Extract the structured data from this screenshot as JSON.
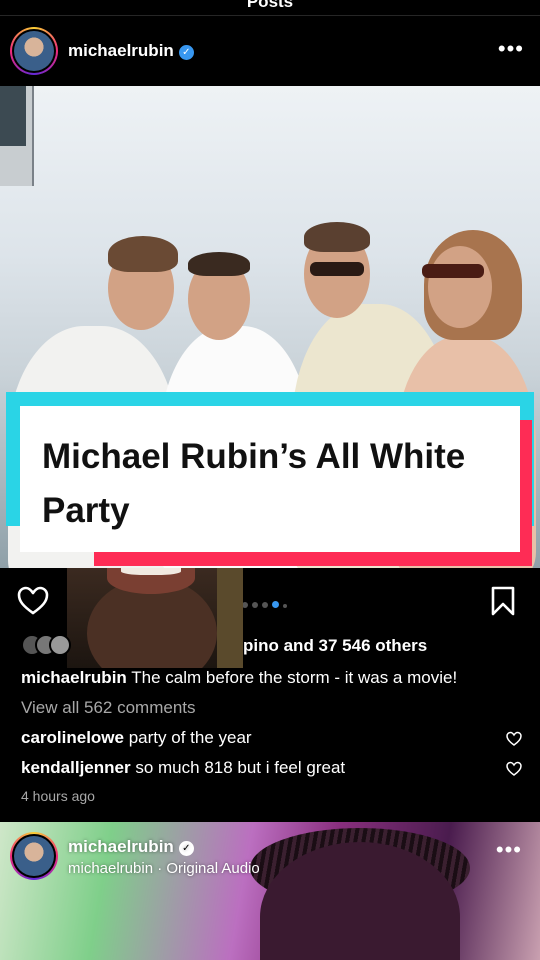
{
  "header": {
    "title": "Posts"
  },
  "post": {
    "username": "michaelrubin",
    "verified_glyph": "✓",
    "more_glyph": "•••",
    "image": {
      "overlay_title_line1": "Michael Rubin’s All White",
      "overlay_title_line2": "Party",
      "carousel_total": 5,
      "carousel_active": 3
    },
    "likes_text": "pino and 37 546 others",
    "caption_user": "michaelrubin",
    "caption_text": "The calm before the storm - it was a movie!",
    "view_comments": "View all 562 comments",
    "comments": [
      {
        "user": "carolinelowe",
        "text": "party of the year"
      },
      {
        "user": "kendalljenner",
        "text": "so much 818 but i feel great"
      }
    ],
    "timestamp": "4 hours ago"
  },
  "next_post": {
    "username": "michaelrubin",
    "audio": "michaelrubin · Original Audio",
    "more_glyph": "•••"
  },
  "icons": {
    "heart": "heart-icon",
    "bookmark": "bookmark-icon",
    "verified": "verified-badge-icon"
  },
  "colors": {
    "accent_blue": "#3897f0",
    "tiktok_cyan": "#2ad4e6",
    "tiktok_pink": "#fe2c55"
  }
}
